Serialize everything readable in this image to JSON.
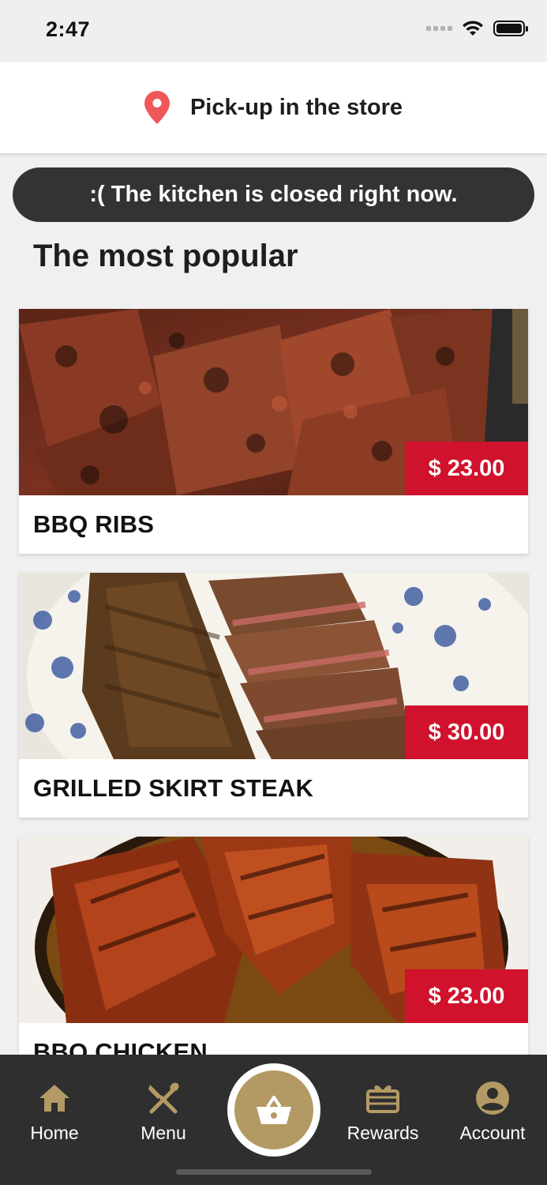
{
  "status_bar": {
    "time": "2:47"
  },
  "header": {
    "pickup_label": "Pick-up in the store"
  },
  "banner": {
    "closed_message": ":( The kitchen is closed right now."
  },
  "section": {
    "title": "The most popular"
  },
  "products": [
    {
      "name": "BBQ RIBS",
      "price": "$ 23.00"
    },
    {
      "name": "GRILLED SKIRT STEAK",
      "price": "$ 30.00"
    },
    {
      "name": "BBQ CHICKEN",
      "price": "$ 23.00"
    }
  ],
  "nav": {
    "items": [
      {
        "label": "Home",
        "icon": "home-icon"
      },
      {
        "label": "Menu",
        "icon": "utensils-icon"
      },
      {
        "label": "",
        "icon": "basket-icon"
      },
      {
        "label": "Rewards",
        "icon": "gift-icon"
      },
      {
        "label": "Account",
        "icon": "account-icon"
      }
    ]
  },
  "colors": {
    "accent": "#b39a64",
    "price_tag": "#d0122c",
    "banner": "#333333",
    "location_pin": "#f0575a"
  }
}
